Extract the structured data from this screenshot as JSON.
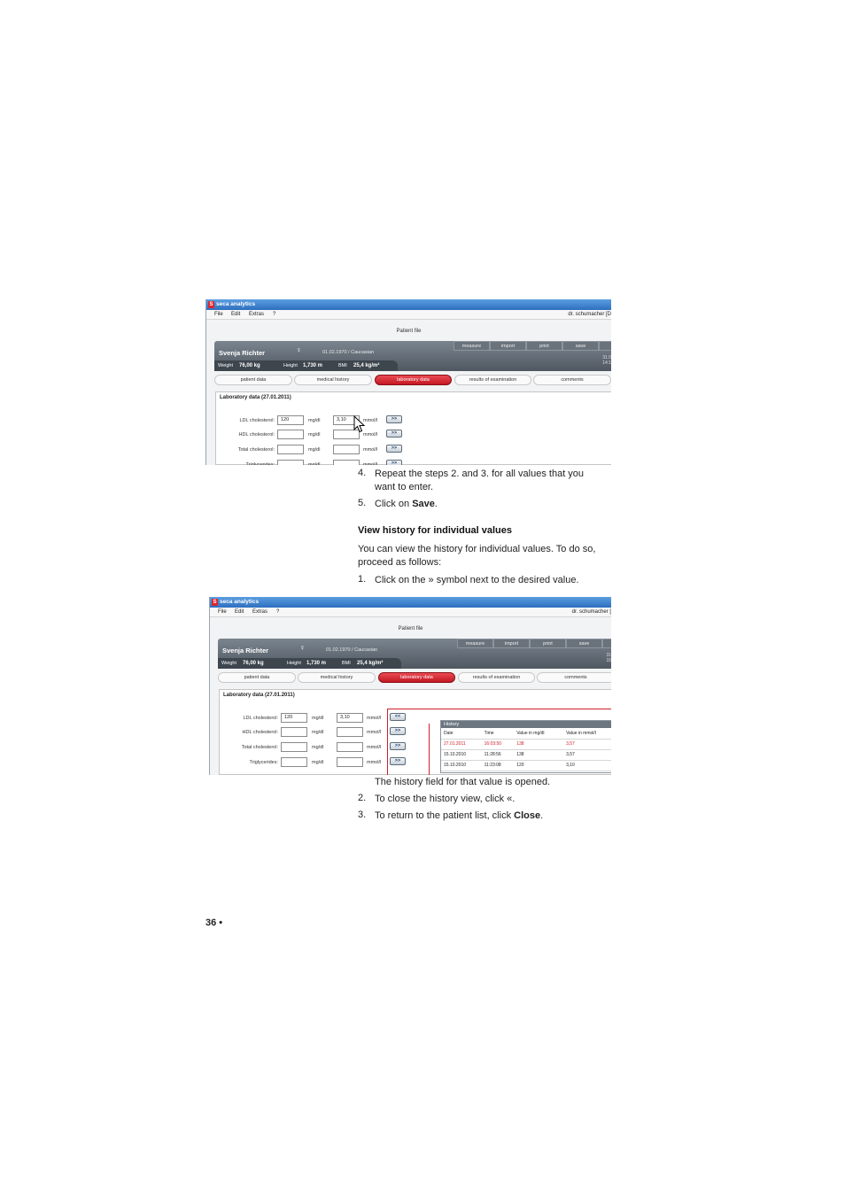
{
  "screenshot1": {
    "app_title": "seca analytics",
    "app_logo": "S",
    "menu": [
      "File",
      "Edit",
      "Extras",
      "?"
    ],
    "user": "dr. schumacher [D",
    "window_title": "Patient file",
    "patient": {
      "name": "Svenja Richter",
      "gender_symbol": "♀",
      "dob_ethnicity": "01.02.1970  /  Caucasian",
      "weight_label": "Weight",
      "weight": "76,00 kg",
      "height_label": "Height",
      "height": "1,730 m",
      "bmi_label": "BMI",
      "bmi": "25,4 kg/m²",
      "right_info": [
        "31.0",
        "14:1"
      ]
    },
    "toolbar": [
      "measure",
      "import",
      "print",
      "save"
    ],
    "tabs": [
      "patient data",
      "medical history",
      "laboratory data",
      "results of examination",
      "comments"
    ],
    "active_tab": 2,
    "panel_title": "Laboratory data (27.01.2011)",
    "rows": [
      {
        "label": "LDL cholesterol:",
        "v1": "120",
        "u1": "mg/dl",
        "v2": "3,10",
        "u2": "mmol/l",
        "btn": ">>"
      },
      {
        "label": "HDL cholesterol:",
        "v1": "",
        "u1": "mg/dl",
        "v2": "",
        "u2": "mmol/l",
        "btn": ">>"
      },
      {
        "label": "Total cholesterol:",
        "v1": "",
        "u1": "mg/dl",
        "v2": "",
        "u2": "mmol/l",
        "btn": ">>"
      },
      {
        "label": "Triglycerides:",
        "v1": "",
        "u1": "mg/dl",
        "v2": "",
        "u2": "mmol/l",
        "btn": ">>"
      }
    ]
  },
  "screenshot2": {
    "app_title": "seca analytics",
    "app_logo": "S",
    "menu": [
      "File",
      "Edit",
      "Extras",
      "?"
    ],
    "user": "dr. schumacher [",
    "window_title": "Patient file",
    "patient": {
      "name": "Svenja Richter",
      "gender_symbol": "♀",
      "dob_ethnicity": "01.02.1970  /  Caucasian",
      "weight_label": "Weight",
      "weight": "76,00 kg",
      "height_label": "Height",
      "height": "1,730 m",
      "bmi_label": "BMI",
      "bmi": "25,4 kg/m²",
      "right_info": [
        "31",
        "15"
      ]
    },
    "toolbar": [
      "measure",
      "import",
      "print",
      "save"
    ],
    "tabs": [
      "patient data",
      "medical history",
      "laboratory data",
      "results of examination",
      "comments"
    ],
    "active_tab": 2,
    "panel_title": "Laboratory data (27.01.2011)",
    "rows": [
      {
        "label": "LDL cholesterol:",
        "v1": "120",
        "u1": "mg/dl",
        "v2": "3,10",
        "u2": "mmol/l",
        "btn": "<<"
      },
      {
        "label": "HDL cholesterol:",
        "v1": "",
        "u1": "mg/dl",
        "v2": "",
        "u2": "mmol/l",
        "btn": ">>"
      },
      {
        "label": "Total cholesterol:",
        "v1": "",
        "u1": "mg/dl",
        "v2": "",
        "u2": "mmol/l",
        "btn": ">>"
      },
      {
        "label": "Triglycerides:",
        "v1": "",
        "u1": "mg/dl",
        "v2": "",
        "u2": "mmol/l",
        "btn": ">>"
      }
    ],
    "history": {
      "title": "History",
      "headers": [
        "Date",
        "Time",
        "Value in mg/dl",
        "Value in mmol/l"
      ],
      "rows": [
        [
          "27.01.2011",
          "16:03:50",
          "138",
          "3,57"
        ],
        [
          "15.10.2010",
          "11:28:56",
          "138",
          "3,57"
        ],
        [
          "15.10.2010",
          "11:23:08",
          "120",
          "3,10"
        ]
      ]
    }
  },
  "text": {
    "step4_num": "4.",
    "step4": "Repeat the steps 2. and 3. for all values that you want to enter.",
    "step5_num": "5.",
    "step5_pre": "Click on ",
    "step5_bold": "Save",
    "step5_post": ".",
    "heading": "View history for individual values",
    "intro": "You can view the history for individual values.  To do so, proceed as follows:",
    "s1_num": "1.",
    "s1": "Click on the » symbol next to the desired value.",
    "result": "The history field for that value is opened.",
    "s2_num": "2.",
    "s2": "To close the history view, click «.",
    "s3_num": "3.",
    "s3_pre": "To return to the patient list, click ",
    "s3_bold": "Close",
    "s3_post": "."
  },
  "page_number": "36 •"
}
